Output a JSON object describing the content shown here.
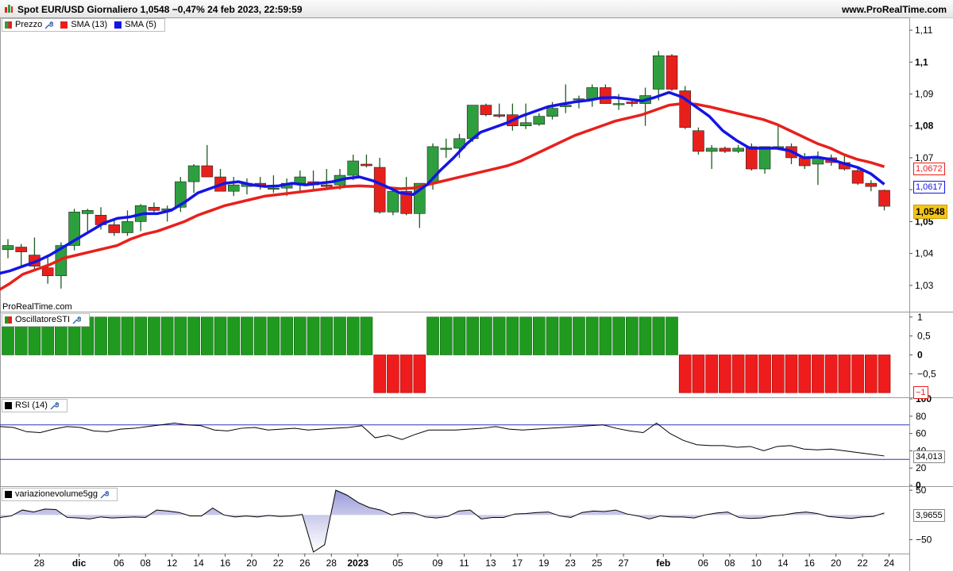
{
  "window": {
    "title": "Spot EUR/USD Giornaliero 1,0548 −0,47% 24 feb 2023, 22:59:59",
    "brand": "www.ProRealTime.com",
    "watermark": "ProRealTime.com"
  },
  "colors": {
    "up": "#2e9f3f",
    "down": "#e8201c",
    "sma13": "#e8201c",
    "sma5": "#1414e6",
    "osc_up": "#1f9a1f",
    "osc_down": "#ee1c1c"
  },
  "legends": {
    "price": {
      "prezzo": "Prezzo",
      "sma13": "SMA (13)",
      "sma5": "SMA (5)"
    },
    "osc": "OscillatoreSTI",
    "rsi": "RSI (14)",
    "vol": "variazionevolume5gg"
  },
  "price_axis": {
    "ticks": [
      "1,11",
      "1,1",
      "1,09",
      "1,08",
      "1,07",
      "1,06",
      "1,05",
      "1,04",
      "1,03"
    ],
    "tags": {
      "sma13": "1,0672",
      "sma5": "1,0617",
      "last": "1,0548"
    }
  },
  "osc_axis": {
    "ticks": [
      "1",
      "0,5",
      "0",
      "−0,5"
    ],
    "tag": "−1"
  },
  "rsi_axis": {
    "ticks": [
      "100",
      "80",
      "60",
      "40",
      "20",
      "0"
    ],
    "tag": "34,013"
  },
  "vol_axis": {
    "ticks": [
      "50",
      "−50"
    ],
    "tag": "3,9655"
  },
  "x_axis": {
    "labels": [
      "28",
      "dic",
      "06",
      "08",
      "12",
      "14",
      "16",
      "20",
      "22",
      "26",
      "28",
      "2023",
      "05",
      "09",
      "11",
      "13",
      "17",
      "19",
      "23",
      "25",
      "27",
      "feb",
      "06",
      "08",
      "10",
      "14",
      "16",
      "20",
      "22",
      "24"
    ]
  },
  "chart_data": {
    "type": "candlestick",
    "series": [
      {
        "name": "Prezzo",
        "ohlc": [
          [
            1.0412,
            1.0445,
            1.0385,
            1.0425
          ],
          [
            1.042,
            1.043,
            1.0355,
            1.0405
          ],
          [
            1.0395,
            1.045,
            1.0345,
            1.036
          ],
          [
            1.0355,
            1.0395,
            1.0305,
            1.033
          ],
          [
            1.033,
            1.0435,
            1.029,
            1.0425
          ],
          [
            1.0425,
            1.054,
            1.041,
            1.053
          ],
          [
            1.0525,
            1.054,
            1.047,
            1.0535
          ],
          [
            1.052,
            1.0545,
            1.0475,
            1.049
          ],
          [
            1.049,
            1.051,
            1.0455,
            1.0465
          ],
          [
            1.0465,
            1.0535,
            1.0455,
            1.05
          ],
          [
            1.05,
            1.0555,
            1.047,
            1.055
          ],
          [
            1.0545,
            1.056,
            1.053,
            1.0535
          ],
          [
            1.0535,
            1.055,
            1.05,
            1.054
          ],
          [
            1.0545,
            1.064,
            1.053,
            1.0625
          ],
          [
            1.0625,
            1.068,
            1.059,
            1.0675
          ],
          [
            1.0675,
            1.074,
            1.064,
            1.064
          ],
          [
            1.064,
            1.0665,
            1.0595,
            1.0595
          ],
          [
            1.0595,
            1.064,
            1.058,
            1.0615
          ],
          [
            1.061,
            1.0635,
            1.0585,
            1.062
          ],
          [
            1.062,
            1.064,
            1.06,
            1.061
          ],
          [
            1.0605,
            1.0645,
            1.059,
            1.0605
          ],
          [
            1.0605,
            1.0635,
            1.058,
            1.062
          ],
          [
            1.062,
            1.066,
            1.0595,
            1.064
          ],
          [
            1.0625,
            1.066,
            1.06,
            1.0615
          ],
          [
            1.0615,
            1.0665,
            1.06,
            1.061
          ],
          [
            1.0615,
            1.0665,
            1.06,
            1.0645
          ],
          [
            1.0645,
            1.071,
            1.063,
            1.069
          ],
          [
            1.068,
            1.071,
            1.067,
            1.0675
          ],
          [
            1.067,
            1.07,
            1.0525,
            1.053
          ],
          [
            1.053,
            1.06,
            1.052,
            1.0595
          ],
          [
            1.0595,
            1.064,
            1.052,
            1.0525
          ],
          [
            1.0525,
            1.061,
            1.048,
            1.062
          ],
          [
            1.062,
            1.0745,
            1.06,
            1.0735
          ],
          [
            1.073,
            1.076,
            1.07,
            1.073
          ],
          [
            1.073,
            1.0775,
            1.07,
            1.076
          ],
          [
            1.076,
            1.079,
            1.075,
            1.0865
          ],
          [
            1.0865,
            1.087,
            1.083,
            1.0835
          ],
          [
            1.0835,
            1.087,
            1.0825,
            1.083
          ],
          [
            1.0835,
            1.087,
            1.0785,
            1.08
          ],
          [
            1.08,
            1.087,
            1.079,
            1.081
          ],
          [
            1.0805,
            1.084,
            1.08,
            1.083
          ],
          [
            1.083,
            1.0875,
            1.082,
            1.0855
          ],
          [
            1.086,
            1.093,
            1.084,
            1.0865
          ],
          [
            1.0885,
            1.0895,
            1.0855,
            1.0885
          ],
          [
            1.0885,
            1.093,
            1.086,
            1.092
          ],
          [
            1.092,
            1.093,
            1.087,
            1.087
          ],
          [
            1.087,
            1.09,
            1.085,
            1.087
          ],
          [
            1.0875,
            1.088,
            1.086,
            1.087
          ],
          [
            1.087,
            1.092,
            1.08,
            1.0895
          ],
          [
            1.0915,
            1.1035,
            1.088,
            1.102
          ],
          [
            1.102,
            1.1025,
            1.091,
            1.0915
          ],
          [
            1.091,
            1.0925,
            1.079,
            1.0795
          ],
          [
            1.0785,
            1.0795,
            1.071,
            1.072
          ],
          [
            1.072,
            1.074,
            1.0665,
            1.073
          ],
          [
            1.073,
            1.0735,
            1.0715,
            1.072
          ],
          [
            1.072,
            1.074,
            1.0715,
            1.073
          ],
          [
            1.0735,
            1.0745,
            1.066,
            1.0665
          ],
          [
            1.0665,
            1.0735,
            1.065,
            1.0735
          ],
          [
            1.0735,
            1.0805,
            1.073,
            1.0735
          ],
          [
            1.0735,
            1.0745,
            1.068,
            1.07
          ],
          [
            1.07,
            1.0715,
            1.0665,
            1.0675
          ],
          [
            1.068,
            1.072,
            1.0615,
            1.07
          ],
          [
            1.07,
            1.071,
            1.0675,
            1.0685
          ],
          [
            1.0685,
            1.0705,
            1.066,
            1.0665
          ],
          [
            1.066,
            1.067,
            1.0615,
            1.062
          ],
          [
            1.062,
            1.063,
            1.0595,
            1.061
          ],
          [
            1.0598,
            1.06,
            1.0535,
            1.0548
          ]
        ]
      },
      {
        "name": "SMA (13)",
        "values": [
          1.028,
          1.0305,
          1.0335,
          1.035,
          1.0365,
          1.0385,
          1.0395,
          1.0405,
          1.0415,
          1.0425,
          1.0445,
          1.046,
          1.047,
          1.0485,
          1.05,
          1.052,
          1.0535,
          1.055,
          1.056,
          1.057,
          1.058,
          1.0585,
          1.059,
          1.0595,
          1.06,
          1.0605,
          1.061,
          1.0612,
          1.061,
          1.0607,
          1.0603,
          1.0605,
          1.0615,
          1.0625,
          1.0635,
          1.0645,
          1.0655,
          1.0665,
          1.0675,
          1.069,
          1.071,
          1.073,
          1.075,
          1.077,
          1.0785,
          1.08,
          1.0815,
          1.0825,
          1.0835,
          1.085,
          1.0865,
          1.087,
          1.0868,
          1.086,
          1.085,
          1.084,
          1.083,
          1.082,
          1.0805,
          1.0785,
          1.0765,
          1.0745,
          1.073,
          1.071,
          1.0695,
          1.0685,
          1.0672
        ]
      },
      {
        "name": "SMA (5)",
        "values": [
          1.0335,
          1.0345,
          1.036,
          1.0375,
          1.0395,
          1.042,
          1.0445,
          1.047,
          1.0495,
          1.051,
          1.0515,
          1.0525,
          1.0525,
          1.0535,
          1.056,
          1.059,
          1.0605,
          1.062,
          1.0625,
          1.0615,
          1.061,
          1.0612,
          1.062,
          1.0615,
          1.062,
          1.0625,
          1.0635,
          1.064,
          1.0628,
          1.061,
          1.059,
          1.0585,
          1.0615,
          1.066,
          1.07,
          1.0745,
          1.078,
          1.0795,
          1.081,
          1.083,
          1.0845,
          1.086,
          1.0868,
          1.0875,
          1.088,
          1.0888,
          1.0889,
          1.0884,
          1.0878,
          1.089,
          1.0905,
          1.089,
          1.086,
          1.083,
          1.0785,
          1.0755,
          1.073,
          1.073,
          1.073,
          1.0722,
          1.07,
          1.0702,
          1.0695,
          1.0682,
          1.067,
          1.065,
          1.0617
        ]
      },
      {
        "name": "OscillatoreSTI",
        "values": [
          1,
          1,
          1,
          1,
          1,
          1,
          1,
          1,
          1,
          1,
          1,
          1,
          1,
          1,
          1,
          1,
          1,
          1,
          1,
          1,
          1,
          1,
          1,
          1,
          1,
          1,
          1,
          1,
          -1,
          -1,
          -1,
          -1,
          1,
          1,
          1,
          1,
          1,
          1,
          1,
          1,
          1,
          1,
          1,
          1,
          1,
          1,
          1,
          1,
          1,
          1,
          1,
          -1,
          -1,
          -1,
          -1,
          -1,
          -1,
          -1,
          -1,
          -1,
          -1,
          -1,
          -1,
          -1,
          -1,
          -1,
          -1
        ]
      },
      {
        "name": "RSI (14)",
        "values": [
          68,
          67,
          62,
          61,
          65,
          68,
          67,
          63,
          62,
          65,
          66,
          68,
          70,
          72,
          70,
          69,
          64,
          63,
          66,
          67,
          64,
          65,
          66,
          64,
          65,
          66,
          67,
          69,
          55,
          58,
          53,
          59,
          64,
          64,
          64,
          65,
          66,
          68,
          65,
          64,
          65,
          66,
          67,
          68,
          69,
          70,
          66,
          63,
          61,
          72,
          60,
          52,
          47,
          46,
          46,
          44,
          45,
          40,
          45,
          46,
          42,
          41,
          42,
          40,
          38,
          36,
          34
        ]
      },
      {
        "name": "variazionevolume5gg",
        "values": [
          -5,
          -2,
          10,
          6,
          12,
          11,
          -5,
          -6,
          -8,
          -4,
          -6,
          -5,
          -4,
          -5,
          10,
          8,
          5,
          -2,
          -2,
          14,
          0,
          -4,
          -2,
          -4,
          -1,
          -3,
          -2,
          1,
          -75,
          -60,
          50,
          40,
          25,
          15,
          10,
          0,
          5,
          4,
          -4,
          -6,
          -3,
          8,
          10,
          -8,
          -5,
          -5,
          2,
          3,
          5,
          6,
          -2,
          -5,
          5,
          8,
          7,
          10,
          2,
          -2,
          -8,
          -2,
          -4,
          -4,
          -6,
          0,
          4,
          6,
          -5,
          -7,
          -6,
          -2,
          0,
          4,
          6,
          3,
          -3,
          -5,
          -7,
          -4,
          -3,
          4
        ]
      }
    ],
    "price_range": [
      1.022,
      1.1135
    ],
    "osc_range": [
      -1.1,
      1.1
    ],
    "rsi_range": [
      0,
      100
    ],
    "rsi_levels": [
      70,
      30
    ],
    "vol_range": [
      -78,
      55
    ]
  }
}
